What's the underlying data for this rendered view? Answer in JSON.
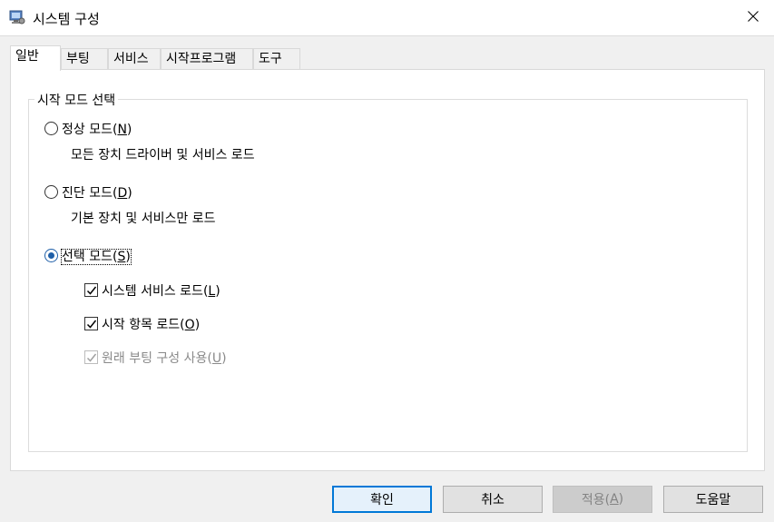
{
  "window": {
    "title": "시스템 구성",
    "icon": "system-config-icon",
    "close_icon": "close-icon"
  },
  "tabs": [
    {
      "label": "일반",
      "active": true
    },
    {
      "label": "부팅",
      "active": false
    },
    {
      "label": "서비스",
      "active": false
    },
    {
      "label": "시작프로그램",
      "active": false
    },
    {
      "label": "도구",
      "active": false
    }
  ],
  "startup_selection": {
    "group_title": "시작 모드 선택",
    "normal": {
      "label": "정상 모드(",
      "mnemonic": "N",
      "suffix": ")",
      "desc": "모든 장치 드라이버 및 서비스 로드",
      "checked": false
    },
    "diagnostic": {
      "label": "진단 모드(",
      "mnemonic": "D",
      "suffix": ")",
      "desc": "기본 장치 및 서비스만 로드",
      "checked": false
    },
    "selective": {
      "label": "선택 모드(",
      "mnemonic": "S",
      "suffix": ")",
      "checked": true
    },
    "options": [
      {
        "label": "시스템 서비스 로드(",
        "mnemonic": "L",
        "suffix": ")",
        "checked": true,
        "enabled": true
      },
      {
        "label": "시작 항목 로드(",
        "mnemonic": "O",
        "suffix": ")",
        "checked": true,
        "enabled": true
      },
      {
        "label": "원래 부팅 구성 사용(",
        "mnemonic": "U",
        "suffix": ")",
        "checked": true,
        "enabled": false
      }
    ]
  },
  "buttons": {
    "ok": "확인",
    "cancel": "취소",
    "apply_label": "적용(",
    "apply_mnemonic": "A",
    "apply_suffix": ")",
    "help": "도움말"
  },
  "colors": {
    "accent": "#0078d7",
    "radio_selected": "#1f5fa8"
  }
}
